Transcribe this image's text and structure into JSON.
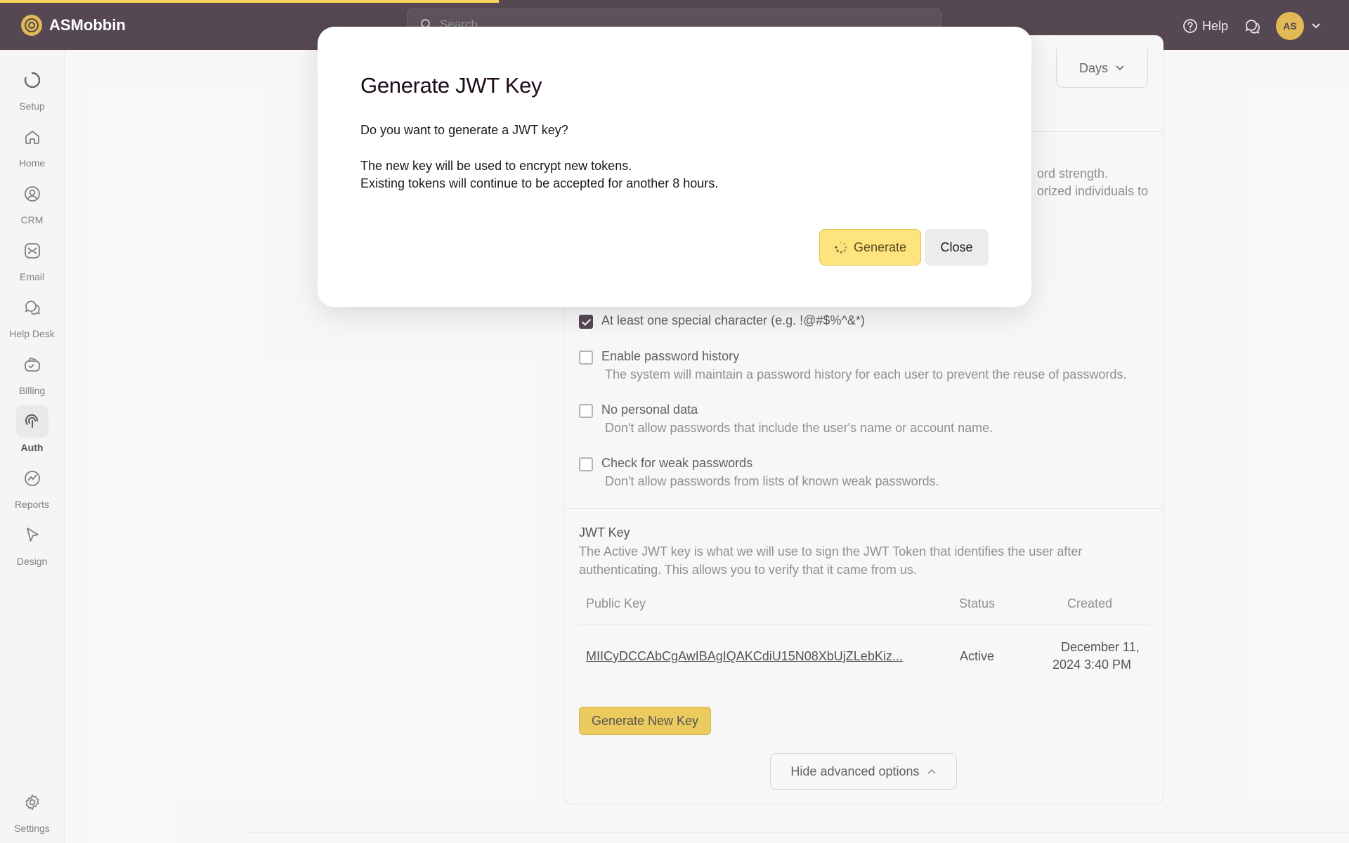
{
  "app": {
    "name": "ASMobbin",
    "brand_color": "#d9a21b",
    "topbar_color": "#1c0b1a"
  },
  "search": {
    "placeholder": "Search"
  },
  "topbar": {
    "help_label": "Help",
    "avatar_initials": "AS"
  },
  "loading_progress": 0.37,
  "sidebar": {
    "items": [
      {
        "label": "Setup",
        "icon": "loading-circle-icon"
      },
      {
        "label": "Home",
        "icon": "home-icon"
      },
      {
        "label": "CRM",
        "icon": "contact-icon"
      },
      {
        "label": "Email",
        "icon": "email-icon"
      },
      {
        "label": "Help Desk",
        "icon": "chat-bubbles-icon"
      },
      {
        "label": "Billing",
        "icon": "billing-icon"
      },
      {
        "label": "Auth",
        "icon": "auth-icon",
        "active": true
      },
      {
        "label": "Reports",
        "icon": "reports-icon"
      },
      {
        "label": "Design",
        "icon": "cursor-icon"
      },
      {
        "label": "Settings",
        "icon": "gear-icon"
      }
    ]
  },
  "background": {
    "days_select": "Days",
    "pw_text_line1": "ord strength.",
    "pw_text_line2": "orized individuals to",
    "checks": [
      {
        "label": "At least one special character (e.g. !@#$%^&*)",
        "checked": true,
        "desc": ""
      },
      {
        "label": "Enable password history",
        "checked": false,
        "desc": "The system will maintain a password history for each user to prevent the reuse of passwords."
      },
      {
        "label": "No personal data",
        "checked": false,
        "desc": "Don't allow passwords that include the user's name or account name."
      },
      {
        "label": "Check for weak passwords",
        "checked": false,
        "desc": "Don't allow passwords from lists of known weak passwords."
      }
    ],
    "jwt": {
      "title": "JWT Key",
      "description": "The Active JWT key is what we will use to sign the JWT Token that identifies the user after authenticating. This allows you to verify that it came from us.",
      "columns": [
        "Public Key",
        "Status",
        "Created"
      ],
      "rows": [
        {
          "public_key": "MIICyDCCAbCgAwIBAgIQAKCdiU15N08XbUjZLebKiz...",
          "status": "Active",
          "created_line1": "December 11,",
          "created_line2": "2024 3:40 PM"
        }
      ],
      "generate_new_key": "Generate New Key",
      "hide_advanced": "Hide advanced options"
    }
  },
  "modal": {
    "title": "Generate JWT Key",
    "question": "Do you want to generate a JWT key?",
    "line1": "The new key will be used to encrypt new tokens.",
    "line2": "Existing tokens will continue to be accepted for another 8 hours.",
    "generate_label": "Generate",
    "close_label": "Close"
  }
}
